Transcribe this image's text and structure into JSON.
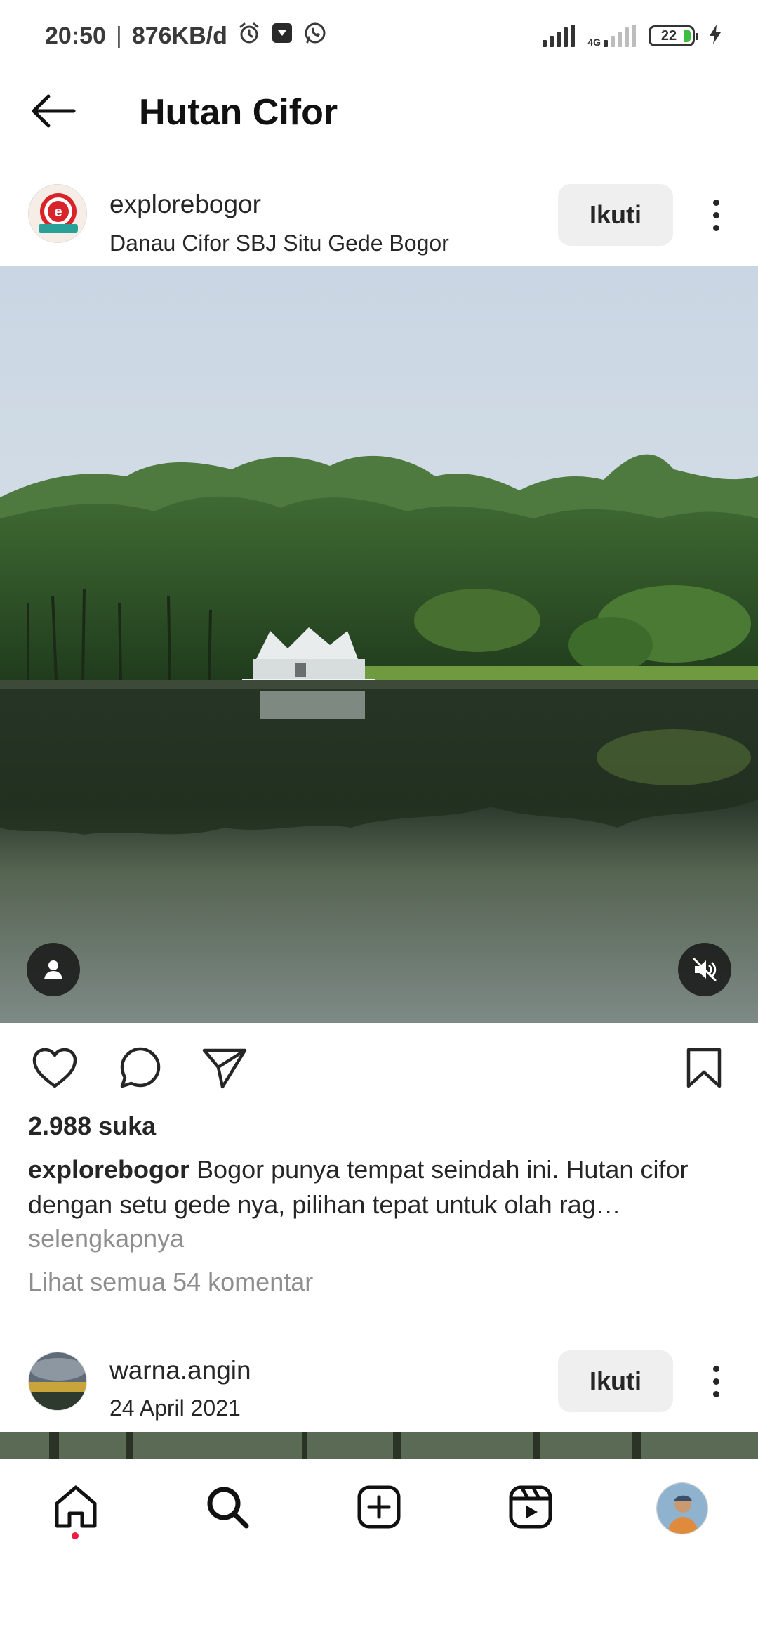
{
  "status_bar": {
    "time": "20:50",
    "separator": "|",
    "data_rate": "876KB/d",
    "network_label": "4G",
    "battery_level": "22",
    "icons": [
      "alarm-icon",
      "app-notification-icon",
      "whatsapp-icon",
      "signal-icon",
      "signal-4g-icon",
      "battery-icon",
      "charging-icon"
    ]
  },
  "header": {
    "title": "Hutan Cifor",
    "back_icon": "arrow-left-icon"
  },
  "post": {
    "username": "explorebogor",
    "location": "Danau Cifor SBJ Situ Gede Bogor",
    "follow_label": "Ikuti",
    "likes": "2.988 suka",
    "caption_user": "explorebogor",
    "caption_text": "Bogor punya tempat seindah ini. Hutan cifor dengan setu gede nya, pilihan tepat untuk olah rag…",
    "more_label": "selengkapnya",
    "comments_label": "Lihat semua 54 komentar"
  },
  "next_post": {
    "username": "warna.angin",
    "date": "24 April 2021",
    "follow_label": "Ikuti"
  },
  "colors": {
    "text": "#262626",
    "muted": "#8e8e8e",
    "button_bg": "#efefef",
    "notification_dot": "#ed1c40"
  },
  "nav": {
    "items": [
      "home-icon",
      "search-icon",
      "create-post-icon",
      "reels-icon",
      "profile-avatar"
    ]
  }
}
